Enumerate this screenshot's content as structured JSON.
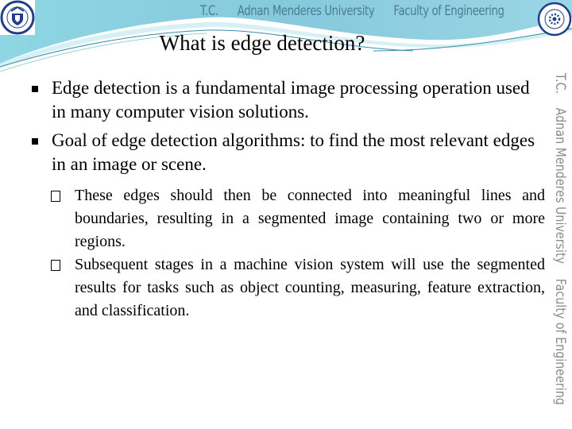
{
  "banner": {
    "items": [
      "T.C.",
      "Adnan Menderes University",
      "Faculty of Engineering"
    ],
    "color": "#4a7d91"
  },
  "side_banner": {
    "items": [
      "T.C.",
      "Adnan Menderes University",
      "Faculty of Engineering"
    ],
    "color": "#8c8c8c"
  },
  "logos": {
    "left": "university-seal-icon",
    "right": "faculty-seal-icon"
  },
  "slide": {
    "title": "What is edge detection?",
    "bullets": [
      {
        "text": "Edge detection is a fundamental image processing operation used in many computer vision solutions."
      },
      {
        "text": "Goal of edge detection algorithms: to find the most relevant edges in an image or scene."
      }
    ],
    "sub_bullets": [
      {
        "text": "These edges should then be connected into meaningful lines and boundaries, resulting in a segmented  image containing two or more regions."
      },
      {
        "text": "Subsequent stages in a machine vision system will use the segmented results for tasks such as object counting, measuring, feature extraction, and classification."
      }
    ]
  },
  "colors": {
    "wave_dark": "#7cc4d6",
    "wave_light": "#b9e6ef",
    "wave_line": "#3a8fa8"
  }
}
